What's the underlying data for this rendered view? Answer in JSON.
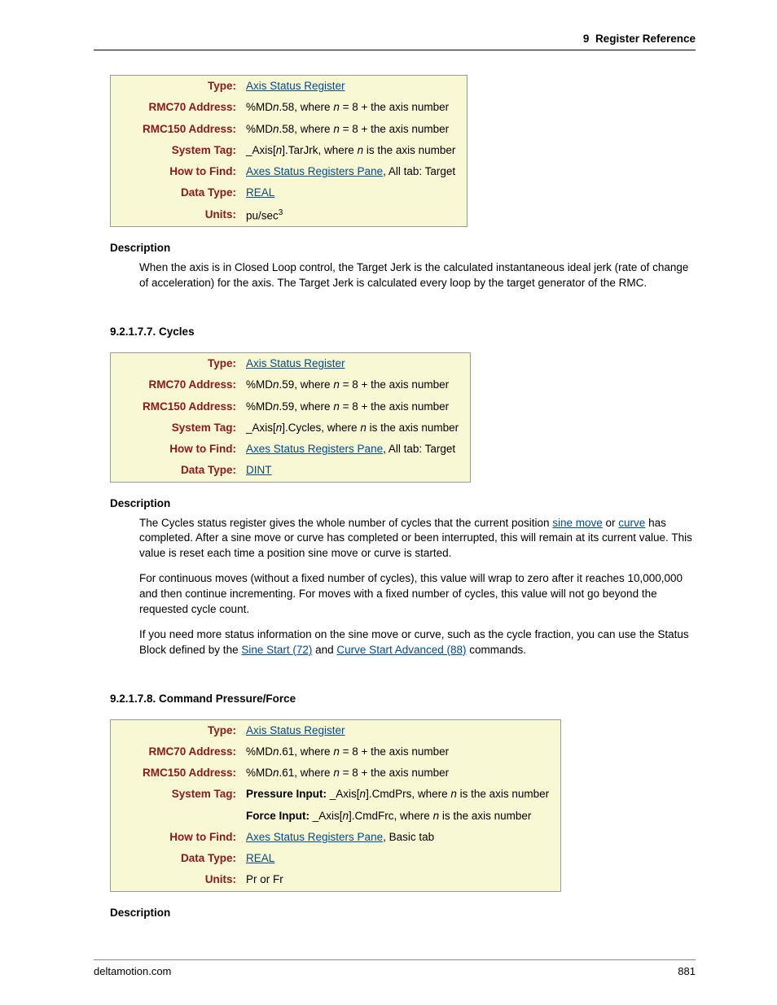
{
  "header": {
    "chapter": "9",
    "title": "Register Reference"
  },
  "labels": {
    "type": "Type:",
    "rmc70": "RMC70 Address:",
    "rmc150": "RMC150 Address:",
    "systag": "System Tag:",
    "howfind": "How to Find:",
    "dtype": "Data Type:",
    "units": "Units:",
    "description": "Description"
  },
  "section1": {
    "type_link": "Axis Status Register",
    "rmc70_pre": "%MD",
    "rmc70_post": ".58, where ",
    "rmc70_eq": " = 8 + the axis number",
    "rmc150_pre": "%MD",
    "rmc150_post": ".58, where ",
    "rmc150_eq": " = 8 + the axis number",
    "systag_pre": "_Axis[",
    "systag_post": "].TarJrk, where ",
    "systag_tail": " is the axis number",
    "howfind_link": "Axes Status Registers Pane",
    "howfind_tail": ", All tab: Target",
    "dtype_link": "REAL",
    "units_txt": "pu/sec",
    "units_sup": "3",
    "desc": "When the axis is in Closed Loop control, the Target Jerk is the calculated instantaneous ideal jerk (rate of change of acceleration) for the axis. The Target Jerk is calculated every loop by the target generator of the RMC."
  },
  "section2": {
    "heading": "9.2.1.7.7. Cycles",
    "type_link": "Axis Status Register",
    "rmc70_pre": "%MD",
    "rmc70_post": ".59, where ",
    "rmc70_eq": " = 8 + the axis number",
    "rmc150_pre": "%MD",
    "rmc150_post": ".59, where ",
    "rmc150_eq": " = 8 + the axis number",
    "systag_pre": "_Axis[",
    "systag_post": "].Cycles, where ",
    "systag_tail": " is the axis number",
    "howfind_link": "Axes Status Registers Pane",
    "howfind_tail": ", All tab: Target",
    "dtype_link": "DINT",
    "desc_p1a": "The Cycles status register gives the whole number of cycles that the current position ",
    "desc_p1_link1": "sine move",
    "desc_p1b": " or ",
    "desc_p1_link2": "curve",
    "desc_p1c": " has completed. After a sine move or curve has completed or been interrupted, this will remain at its current value. This value is reset each time a position sine move or curve is started.",
    "desc_p2": "For continuous moves (without a fixed number of cycles), this value will wrap to zero after it reaches 10,000,000 and then continue incrementing. For moves with a fixed number of cycles, this value will not go beyond the requested cycle count.",
    "desc_p3a": "If you need more status information on the sine move or curve, such as the cycle fraction, you can use the Status Block defined by the ",
    "desc_p3_link1": "Sine Start (72)",
    "desc_p3b": " and ",
    "desc_p3_link2": "Curve Start Advanced (88)",
    "desc_p3c": " commands."
  },
  "section3": {
    "heading": "9.2.1.7.8. Command Pressure/Force",
    "type_link": "Axis Status Register",
    "rmc70_pre": "%MD",
    "rmc70_post": ".61, where ",
    "rmc70_eq": " = 8 + the axis number",
    "rmc150_pre": "%MD",
    "rmc150_post": ".61, where ",
    "rmc150_eq": " = 8 + the axis number",
    "systag_p_label": "Pressure Input:",
    "systag_p_pre": " _Axis[",
    "systag_p_post": "].CmdPrs, where ",
    "systag_p_tail": " is the axis number",
    "systag_f_label": "Force Input:",
    "systag_f_pre": " _Axis[",
    "systag_f_post": "].CmdFrc, where ",
    "systag_f_tail": " is the axis number",
    "howfind_link": "Axes Status Registers Pane",
    "howfind_tail": ", Basic tab",
    "dtype_link": "REAL",
    "units_txt": "Pr or Fr"
  },
  "footer": {
    "site": "deltamotion.com",
    "page": "881"
  }
}
